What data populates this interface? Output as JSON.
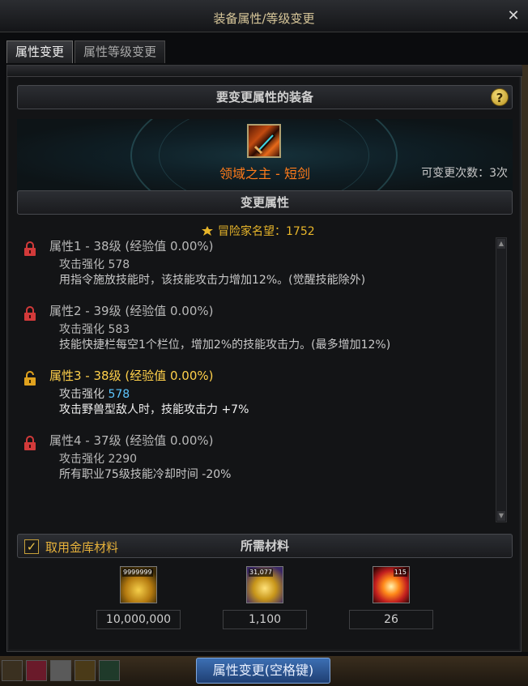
{
  "window": {
    "title": "装备属性/等级变更",
    "close_label": "✕"
  },
  "tabs": [
    {
      "label": "属性变更",
      "active": true
    },
    {
      "label": "属性等级变更",
      "active": false
    }
  ],
  "equipment": {
    "section_title": "要变更属性的装备",
    "help_label": "?",
    "name": "领域之主 - 短剑",
    "change_count": "可变更次数：3次",
    "name_color": "#ff7b1a"
  },
  "attributes_section": {
    "title": "变更属性",
    "fame": "冒险家名望：1752",
    "items": [
      {
        "lock_state": "locked",
        "line1": "属性1 - 38级 (经验值 0.00%)",
        "line2_label": "攻击强化",
        "line2_value": "578",
        "line3": "用指令施放技能时，该技能攻击力增加12%。(觉醒技能除外)"
      },
      {
        "lock_state": "locked",
        "line1": "属性2 - 39级 (经验值 0.00%)",
        "line2_label": "攻击强化",
        "line2_value": "583",
        "line3": "技能快捷栏每空1个栏位，增加2%的技能攻击力。(最多增加12%)"
      },
      {
        "lock_state": "unlocked",
        "line1": "属性3 - 38级 (经验值 0.00%)",
        "line2_label": "攻击强化",
        "line2_value": "578",
        "line3": "攻击野兽型敌人时，技能攻击力 +7%"
      },
      {
        "lock_state": "locked",
        "line1": "属性4 - 37级 (经验值 0.00%)",
        "line2_label": "攻击强化",
        "line2_value": "2290",
        "line3": "所有职业75级技能冷却时间 -20%"
      }
    ]
  },
  "materials": {
    "title": "所需材料",
    "use_vault_label": "取用金库材料",
    "use_vault_checked": true,
    "items": [
      {
        "icon": "gold-coins-icon",
        "stack": "9999999",
        "value": "10,000,000"
      },
      {
        "icon": "gold-gem-icon",
        "stack": "31,077",
        "value": "1,100"
      },
      {
        "icon": "burst-orb-icon",
        "stack": "115",
        "value": "26"
      }
    ]
  },
  "footer": {
    "apply_label": "属性变更(空格键)"
  },
  "colors": {
    "accent_gold": "#e6b13a",
    "locked_red": "#d23a3a",
    "unlocked_gold": "#e0a21e",
    "value_blue": "#5ec6ff"
  }
}
